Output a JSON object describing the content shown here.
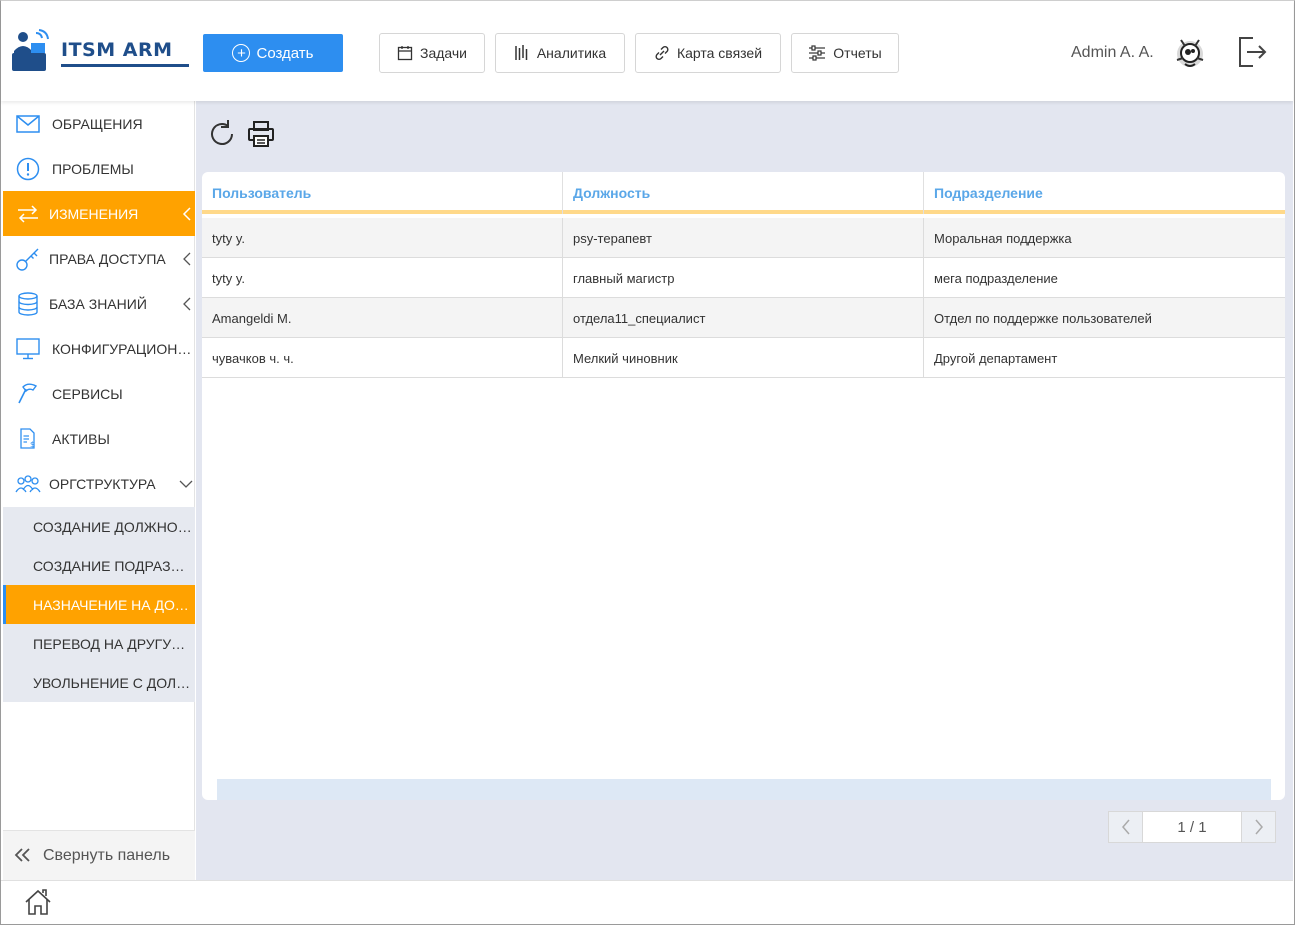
{
  "header": {
    "logo_text": "ITSM ARM",
    "create_label": "Создать",
    "nav": [
      {
        "label": "Задачи",
        "icon": "calendar-icon"
      },
      {
        "label": "Аналитика",
        "icon": "analytics-icon"
      },
      {
        "label": "Карта связей",
        "icon": "link-icon"
      },
      {
        "label": "Отчеты",
        "icon": "sliders-icon"
      }
    ],
    "user_name": "Admin A. A."
  },
  "sidebar": {
    "items": [
      {
        "label": "ОБРАЩЕНИЯ",
        "icon": "envelope-icon"
      },
      {
        "label": "ПРОБЛЕМЫ",
        "icon": "exclamation-icon"
      },
      {
        "label": "ИЗМЕНЕНИЯ",
        "icon": "arrows-icon",
        "active": true
      },
      {
        "label": "ПРАВА ДОСТУПА",
        "icon": "key-icon"
      },
      {
        "label": "БАЗА ЗНАНИЙ",
        "icon": "database-icon"
      },
      {
        "label": "КОНФИГУРАЦИОННЫЕ ЕДИНИЦЫ",
        "icon": "monitor-icon"
      },
      {
        "label": "СЕРВИСЫ",
        "icon": "hammer-icon"
      },
      {
        "label": "АКТИВЫ",
        "icon": "invoice-icon"
      },
      {
        "label": "ОРГСТРУКТУРА",
        "icon": "people-icon"
      }
    ],
    "sub_items": [
      {
        "label": "СОЗДАНИЕ ДОЛЖНОСТИ"
      },
      {
        "label": "СОЗДАНИЕ ПОДРАЗДЕЛЕНИЯ"
      },
      {
        "label": "НАЗНАЧЕНИЕ НА ДОЛЖНОСТЬ",
        "active": true
      },
      {
        "label": "ПЕРЕВОД НА ДРУГУЮ ДОЛЖНОСТЬ"
      },
      {
        "label": "УВОЛЬНЕНИЕ С ДОЛЖНОСТИ"
      }
    ],
    "collapse_label": "Свернуть панель"
  },
  "table": {
    "columns": [
      "Пользователь",
      "Должность",
      "Подразделение"
    ],
    "rows": [
      [
        "tyty y.",
        "psy-терапевт",
        "Моральная поддержка"
      ],
      [
        "tyty y.",
        "главный магистр",
        "мега подразделение"
      ],
      [
        "Amangeldi M.",
        "отдела11_специалист",
        "Отдел по поддержке пользователей"
      ],
      [
        "чувачков ч. ч.",
        "Мелкий чиновник",
        "Другой департамент"
      ]
    ]
  },
  "pager": {
    "label": "1 / 1"
  },
  "colors": {
    "accent": "#ffa200",
    "primary": "#2d8ef0",
    "header_text": "#5aa7e8",
    "brand": "#1f4e8a"
  }
}
